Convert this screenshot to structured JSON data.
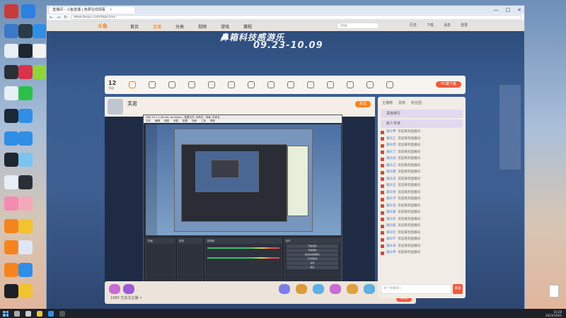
{
  "browser": {
    "tab_title": "直播间 - 斗鱼直播 | 免费在线观看",
    "tab_close": "×",
    "url": "www.douyu.com/topic/xxx",
    "window_controls": [
      "—",
      "□",
      "×"
    ],
    "nav_buttons": [
      "←",
      "→",
      "↻"
    ]
  },
  "site": {
    "logo": "斗鱼",
    "nav_items": [
      "首页",
      "直播",
      "分类",
      "视频",
      "游戏",
      "赛程"
    ],
    "search_placeholder": "搜索",
    "nav_icons": [
      "历史",
      "下载",
      "消息",
      "登录"
    ],
    "banner_title": "鼻箱科技感游乐",
    "banner_date": "09.23-10.09"
  },
  "room": {
    "level_num": "12",
    "level_sub": "等级",
    "pc_button": "PC端下载",
    "streamer_name": "芙君",
    "follow_label": "关注"
  },
  "obs": {
    "title": "OBS 29.1.3 (64-bit, windows) - 配置文件: 未命名 - 场景: 未命名",
    "menu": [
      "文件",
      "编辑",
      "视图",
      "停靠",
      "配置",
      "场景",
      "工具",
      "帮助"
    ],
    "panels": {
      "scenes": "场景",
      "sources": "来源",
      "mixer": "混音器",
      "transitions": "转场",
      "controls": "控件"
    },
    "controls": [
      "开始直播",
      "开始录制",
      "启动虚拟摄像机",
      "工作室模式",
      "设置",
      "退出"
    ]
  },
  "gift_bar": {
    "text": "1983 已关注主播 >",
    "send_label": "发送"
  },
  "chat": {
    "tabs": [
      "主播榜",
      "贵族",
      "粉丝团"
    ],
    "cards": [
      "贵族排行",
      "新人专享"
    ],
    "rows": [
      {
        "user": "观众甲",
        "text": "欢迎来到直播间"
      },
      {
        "user": "观众乙",
        "text": "欢迎来到直播间"
      },
      {
        "user": "观众丙",
        "text": "欢迎来到直播间"
      },
      {
        "user": "观众丁",
        "text": "欢迎来到直播间"
      },
      {
        "user": "观众戊",
        "text": "欢迎来到直播间"
      },
      {
        "user": "观众己",
        "text": "欢迎来到直播间"
      },
      {
        "user": "观众庚",
        "text": "欢迎来到直播间"
      },
      {
        "user": "观众辛",
        "text": "欢迎来到直播间"
      },
      {
        "user": "观众壬",
        "text": "欢迎来到直播间"
      },
      {
        "user": "观众癸",
        "text": "欢迎来到直播间"
      },
      {
        "user": "观众子",
        "text": "欢迎来到直播间"
      },
      {
        "user": "观众丑",
        "text": "欢迎来到直播间"
      },
      {
        "user": "观众寅",
        "text": "欢迎来到直播间"
      },
      {
        "user": "观众卯",
        "text": "欢迎来到直播间"
      },
      {
        "user": "观众辰",
        "text": "欢迎来到直播间"
      },
      {
        "user": "观众巳",
        "text": "欢迎来到直播间"
      },
      {
        "user": "观众午",
        "text": "欢迎来到直播间"
      },
      {
        "user": "观众未",
        "text": "欢迎来到直播间"
      },
      {
        "user": "观众申",
        "text": "欢迎来到直播间"
      }
    ],
    "input_placeholder": "发个弹幕呗~",
    "send_label": "发送"
  },
  "taskbar": {
    "clock_time": "10:28",
    "clock_date": "2023/10/01"
  },
  "colors": {
    "brand": "#f5841f",
    "accent_red": "#f05a3c"
  }
}
